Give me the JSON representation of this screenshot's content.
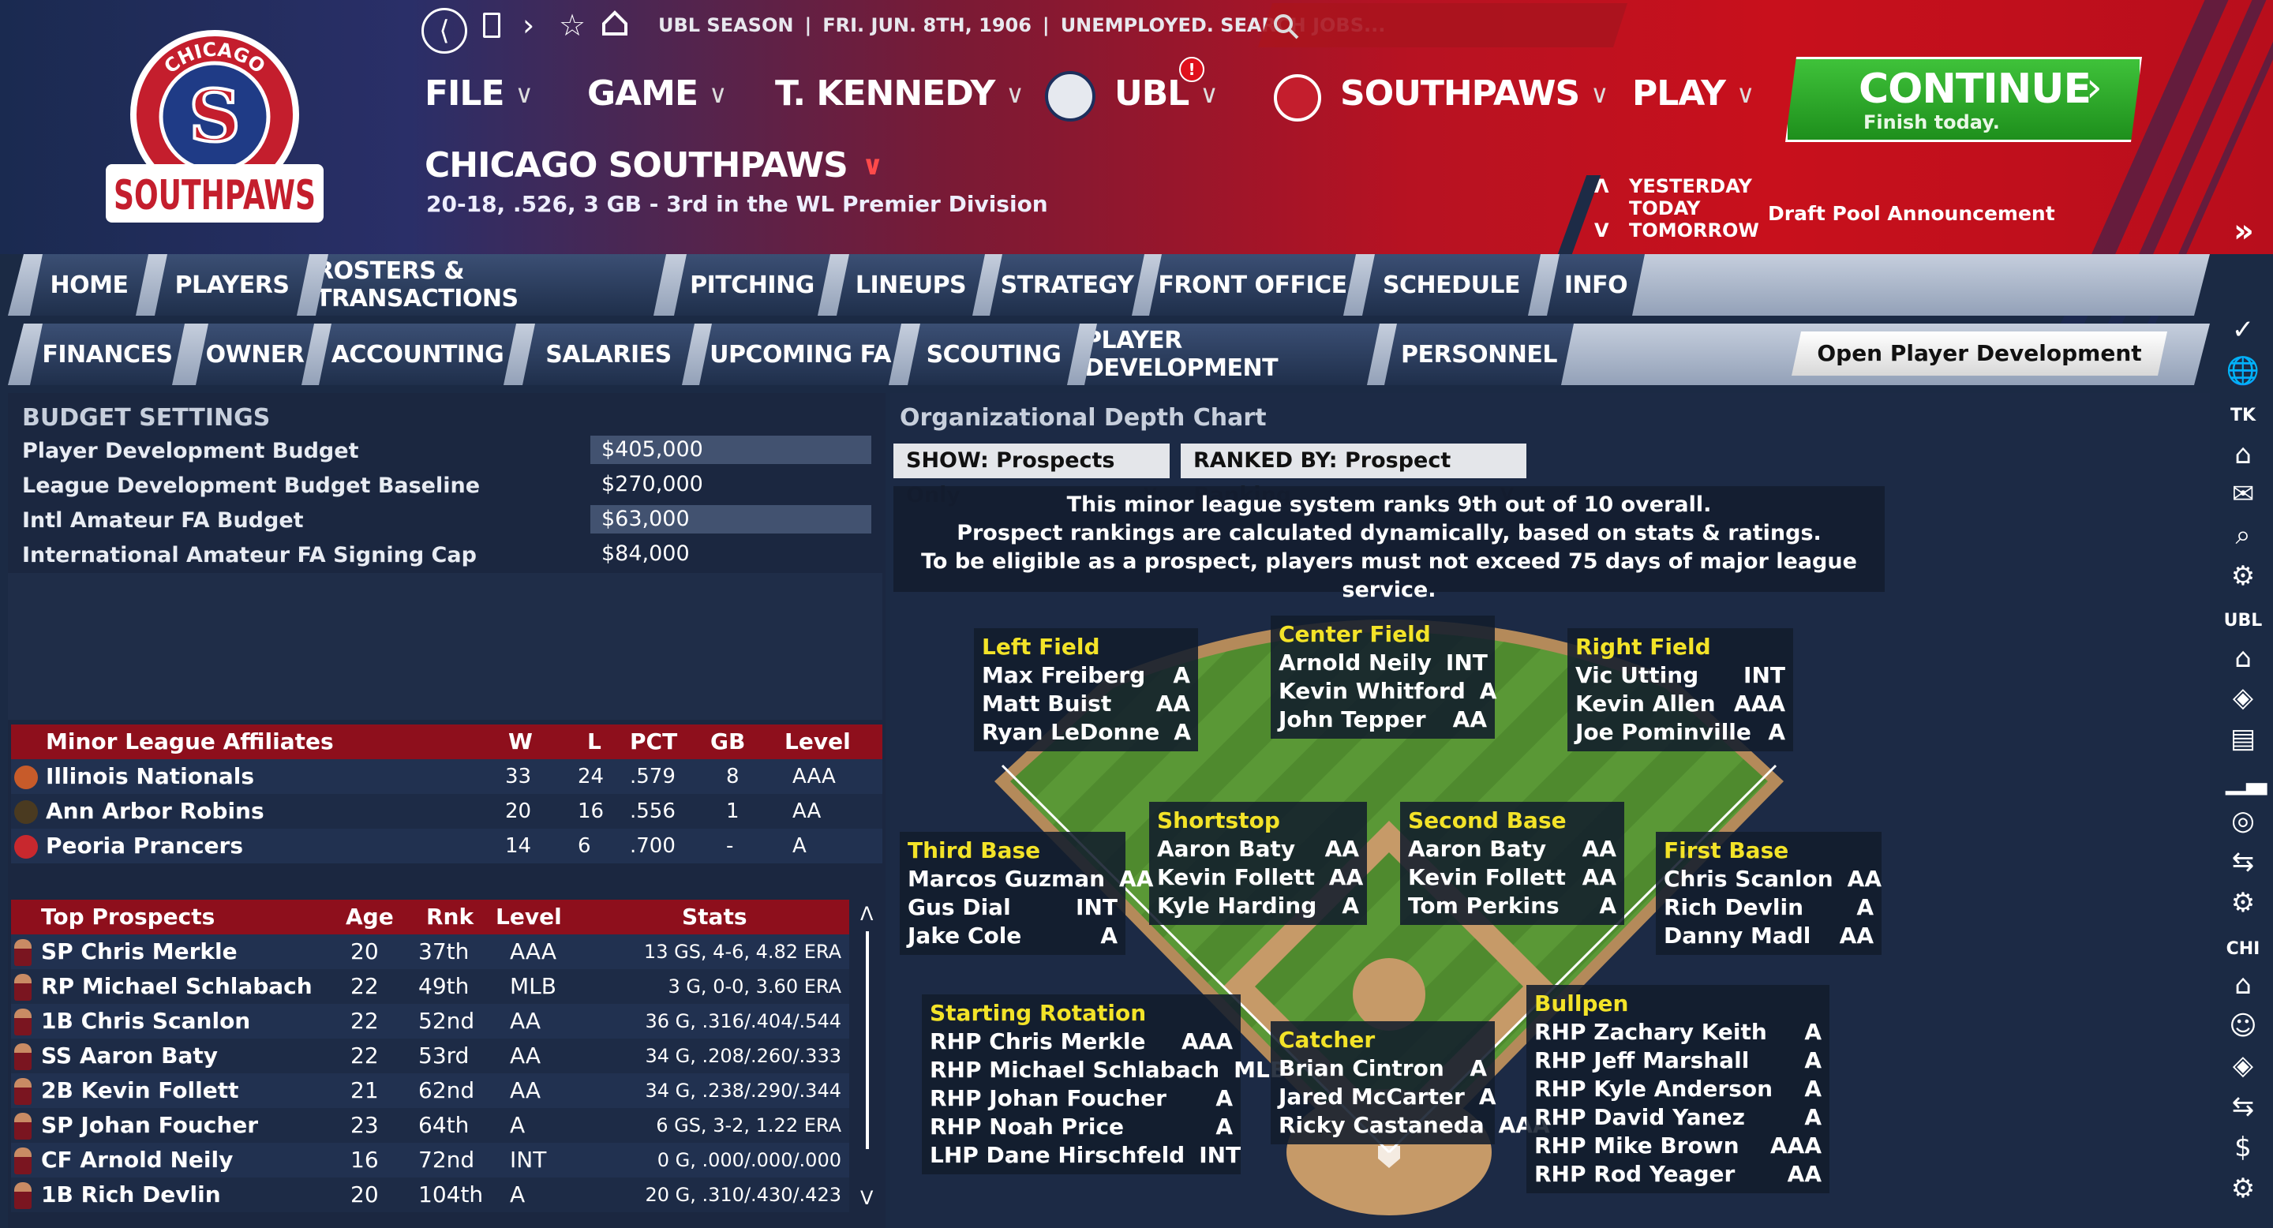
{
  "colors": {
    "header_red": "#c8101c",
    "panel_bg": "#1d2b46",
    "affiliate_header": "#8e0f1c",
    "continue_green": "#2ea82a",
    "position_yellow": "#f3e328"
  },
  "topbar": {
    "season": "UBL SEASON",
    "date": "FRI. JUN. 8TH, 1906",
    "status": "UNEMPLOYED. SEARCH JOBS...",
    "search_placeholder": ""
  },
  "logo": {
    "arc_text": "CHICAGO",
    "wordmark": "SOUTHPAWS",
    "monogram": "S"
  },
  "menu": {
    "file": "FILE",
    "game": "GAME",
    "manager": "T. KENNEDY",
    "league": "UBL",
    "league_badge": "!",
    "team": "SOUTHPAWS",
    "play": "PLAY"
  },
  "team": {
    "name": "CHICAGO SOUTHPAWS",
    "record": "20-18, .526, 3 GB - 3rd in the WL Premier Division"
  },
  "schedule_nav": {
    "yesterday": "YESTERDAY",
    "today": "TODAY",
    "tomorrow": "TOMORROW",
    "event": "Draft Pool Announcement"
  },
  "continue": {
    "label": "CONTINUE",
    "sub": "Finish today."
  },
  "tabs_main": [
    "HOME",
    "PLAYERS",
    "ROSTERS & TRANSACTIONS",
    "PITCHING",
    "LINEUPS",
    "STRATEGY",
    "FRONT OFFICE",
    "SCHEDULE",
    "INFO"
  ],
  "tabs_sub": [
    "FINANCES",
    "OWNER",
    "ACCOUNTING",
    "SALARIES",
    "UPCOMING FA",
    "SCOUTING",
    "PLAYER DEVELOPMENT",
    "PERSONNEL"
  ],
  "report_button": "Open Player Development Report",
  "budget": {
    "title": "BUDGET SETTINGS",
    "rows": [
      {
        "label": "Player Development Budget",
        "value": "$405,000"
      },
      {
        "label": "League Development Budget Baseline",
        "value": "$270,000"
      },
      {
        "label": "Intl Amateur FA Budget",
        "value": "$63,000"
      },
      {
        "label": "International Amateur FA Signing Cap",
        "value": "$84,000"
      }
    ]
  },
  "affiliates": {
    "headers": [
      "Minor League Affiliates",
      "W",
      "L",
      "PCT",
      "GB",
      "Level"
    ],
    "rows": [
      {
        "name": "Illinois Nationals",
        "w": "33",
        "l": "24",
        "pct": ".579",
        "gb": "8",
        "level": "AAA"
      },
      {
        "name": "Ann Arbor Robins",
        "w": "20",
        "l": "16",
        "pct": ".556",
        "gb": "1",
        "level": "AA"
      },
      {
        "name": "Peoria Prancers",
        "w": "14",
        "l": "6",
        "pct": ".700",
        "gb": "-",
        "level": "A"
      }
    ]
  },
  "prospects": {
    "headers": [
      "Top Prospects",
      "Age",
      "Rnk",
      "Level",
      "Stats"
    ],
    "rows": [
      {
        "name": "SP Chris Merkle",
        "age": "20",
        "rnk": "37th",
        "level": "AAA",
        "stats": "13 GS, 4-6, 4.82 ERA"
      },
      {
        "name": "RP Michael Schlabach",
        "age": "22",
        "rnk": "49th",
        "level": "MLB",
        "stats": "3 G, 0-0, 3.60 ERA"
      },
      {
        "name": "1B Chris Scanlon",
        "age": "22",
        "rnk": "52nd",
        "level": "AA",
        "stats": "36 G, .316/.404/.544"
      },
      {
        "name": "SS Aaron Baty",
        "age": "22",
        "rnk": "53rd",
        "level": "AA",
        "stats": "34 G, .208/.260/.333"
      },
      {
        "name": "2B Kevin Follett",
        "age": "21",
        "rnk": "62nd",
        "level": "AA",
        "stats": "34 G, .238/.290/.344"
      },
      {
        "name": "SP Johan Foucher",
        "age": "23",
        "rnk": "64th",
        "level": "A",
        "stats": "6 GS, 3-2, 1.22 ERA"
      },
      {
        "name": "CF Arnold Neily",
        "age": "16",
        "rnk": "72nd",
        "level": "INT",
        "stats": "0 G, .000/.000/.000"
      },
      {
        "name": "1B Rich Devlin",
        "age": "20",
        "rnk": "104th",
        "level": "A",
        "stats": "20 G, .310/.430/.423"
      }
    ]
  },
  "depth": {
    "title": "Organizational Depth Chart",
    "show": "SHOW: Prospects Only",
    "ranked": "RANKED BY: Prospect Ranking",
    "info1": "This minor league system ranks 9th out of 10 overall.",
    "info2": "Prospect rankings are calculated dynamically, based on stats & ratings.",
    "info3": "To be eligible as a prospect, players must not exceed 75 days of major league service.",
    "lf": {
      "title": "Left Field",
      "players": [
        [
          "Max Freiberg",
          "A"
        ],
        [
          "Matt Buist",
          "AA"
        ],
        [
          "Ryan LeDonne",
          "A"
        ]
      ]
    },
    "cf": {
      "title": "Center Field",
      "players": [
        [
          "Arnold Neily",
          "INT"
        ],
        [
          "Kevin Whitford",
          "A"
        ],
        [
          "John Tepper",
          "AA"
        ]
      ]
    },
    "rf": {
      "title": "Right Field",
      "players": [
        [
          "Vic Utting",
          "INT"
        ],
        [
          "Kevin Allen",
          "AAA"
        ],
        [
          "Joe Pominville",
          "A"
        ]
      ]
    },
    "ss": {
      "title": "Shortstop",
      "players": [
        [
          "Aaron Baty",
          "AA"
        ],
        [
          "Kevin Follett",
          "AA"
        ],
        [
          "Kyle Harding",
          "A"
        ]
      ]
    },
    "b2": {
      "title": "Second Base",
      "players": [
        [
          "Aaron Baty",
          "AA"
        ],
        [
          "Kevin Follett",
          "AA"
        ],
        [
          "Tom Perkins",
          "A"
        ]
      ]
    },
    "b3": {
      "title": "Third Base",
      "players": [
        [
          "Marcos Guzman",
          "AA"
        ],
        [
          "Gus Dial",
          "INT"
        ],
        [
          "Jake Cole",
          "A"
        ]
      ]
    },
    "b1": {
      "title": "First Base",
      "players": [
        [
          "Chris Scanlon",
          "AA"
        ],
        [
          "Rich Devlin",
          "A"
        ],
        [
          "Danny Madl",
          "AA"
        ]
      ]
    },
    "sp": {
      "title": "Starting Rotation",
      "players": [
        [
          "RHP Chris Merkle",
          "AAA"
        ],
        [
          "RHP Michael Schlabach",
          "MLB"
        ],
        [
          "RHP Johan Foucher",
          "A"
        ],
        [
          "RHP Noah Price",
          "A"
        ],
        [
          "LHP Dane Hirschfeld",
          "INT"
        ]
      ]
    },
    "c": {
      "title": "Catcher",
      "players": [
        [
          "Brian Cintron",
          "A"
        ],
        [
          "Jared McCarter",
          "A"
        ],
        [
          "Ricky Castaneda",
          "AAA"
        ]
      ]
    },
    "bp": {
      "title": "Bullpen",
      "players": [
        [
          "RHP Zachary Keith",
          "A"
        ],
        [
          "RHP Jeff Marshall",
          "A"
        ],
        [
          "RHP Kyle Anderson",
          "A"
        ],
        [
          "RHP David Yanez",
          "A"
        ],
        [
          "RHP Mike Brown",
          "AAA"
        ],
        [
          "RHP Rod Yeager",
          "AA"
        ]
      ]
    }
  },
  "sidebar": {
    "tk": "TK",
    "ubl": "UBL",
    "chi": "CHI"
  }
}
